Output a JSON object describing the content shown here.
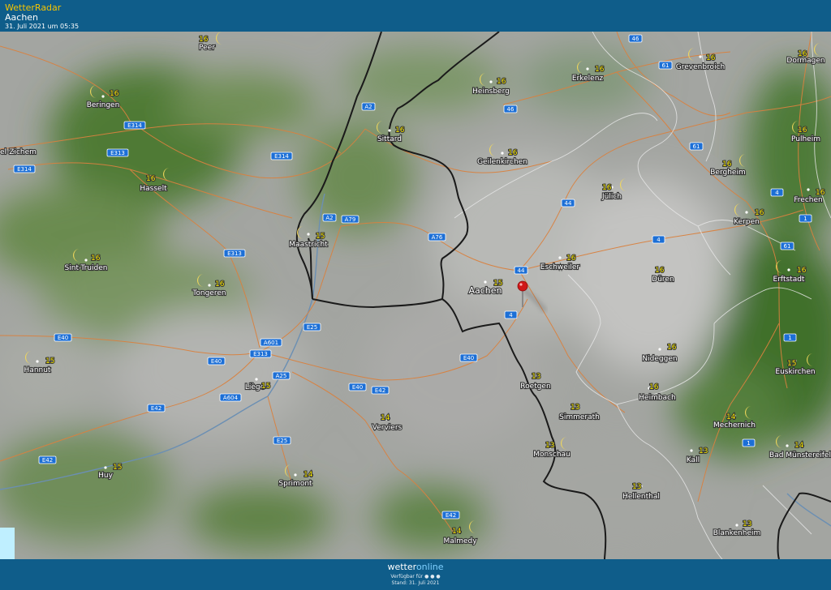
{
  "header": {
    "app_title": "WetterRadar",
    "location": "Aachen",
    "timestamp": "31. Juli 2021 um 05:35"
  },
  "footer": {
    "brand_pre": "wetter",
    "brand_post": "online",
    "available_text": "Verfügbar für",
    "stand_text": "Stand: 31. Juli 2021"
  },
  "colors": {
    "header_bg": "#0f5d8a",
    "accent_yellow": "#f5c400",
    "temperature": "#f6e600",
    "road": "#e0803a",
    "border": "#1a1a1a",
    "marker": "#d01818"
  },
  "marker": {
    "icon": "map-pin-icon",
    "label": "Aachen"
  },
  "cities": [
    {
      "name": "Peer",
      "temp": "16"
    },
    {
      "name": "Beringen",
      "temp": "16"
    },
    {
      "name": "Hasselt",
      "temp": "16"
    },
    {
      "name": "Sint-Truiden",
      "temp": "16"
    },
    {
      "name": "Tongeren",
      "temp": "16"
    },
    {
      "name": "Hannut",
      "temp": "15"
    },
    {
      "name": "Liège",
      "temp": "15"
    },
    {
      "name": "Huy",
      "temp": "15"
    },
    {
      "name": "Maastricht",
      "temp": "15"
    },
    {
      "name": "Sittard",
      "temp": "16"
    },
    {
      "name": "Heinsberg",
      "temp": "16"
    },
    {
      "name": "Geilenkirchen",
      "temp": "16"
    },
    {
      "name": "Erkelenz",
      "temp": "16"
    },
    {
      "name": "Grevenbroich",
      "temp": "16"
    },
    {
      "name": "Dormagen",
      "temp": "16"
    },
    {
      "name": "Pulheim",
      "temp": "16"
    },
    {
      "name": "Bergheim",
      "temp": "16"
    },
    {
      "name": "Jülich",
      "temp": "16"
    },
    {
      "name": "Frechen",
      "temp": "16"
    },
    {
      "name": "Kerpen",
      "temp": "16"
    },
    {
      "name": "Aachen",
      "temp": "15"
    },
    {
      "name": "Eschweiler",
      "temp": "16"
    },
    {
      "name": "Düren",
      "temp": "16"
    },
    {
      "name": "Erftstadt",
      "temp": "16"
    },
    {
      "name": "Nideggen",
      "temp": "16"
    },
    {
      "name": "Heimbach",
      "temp": "16"
    },
    {
      "name": "Euskirchen",
      "temp": "15"
    },
    {
      "name": "Roetgen",
      "temp": "13"
    },
    {
      "name": "Simmerath",
      "temp": "13"
    },
    {
      "name": "Monschau",
      "temp": "13"
    },
    {
      "name": "Mechernich",
      "temp": "14"
    },
    {
      "name": "Kall",
      "temp": "13"
    },
    {
      "name": "Bad Münstereifel",
      "temp": "14"
    },
    {
      "name": "Hellenthal",
      "temp": "13"
    },
    {
      "name": "Blankenheim",
      "temp": "13"
    },
    {
      "name": "Verviers",
      "temp": "14"
    },
    {
      "name": "Sprimont",
      "temp": "14"
    },
    {
      "name": "Malmedy",
      "temp": "14"
    },
    {
      "name": "el-Zichem",
      "temp": ""
    },
    {
      "name": "",
      "temp": "13"
    }
  ],
  "roads": [
    "E314",
    "E313",
    "E314",
    "E314",
    "A2",
    "A2",
    "A79",
    "A76",
    "E313",
    "E40",
    "E40",
    "A601",
    "E313",
    "E25",
    "A25",
    "A604",
    "E42",
    "E42",
    "E40",
    "E42",
    "E25",
    "E42",
    "E40",
    "46",
    "61",
    "46",
    "61",
    "4",
    "44",
    "4",
    "44",
    "4",
    "1",
    "61",
    "1",
    "1",
    "61"
  ]
}
